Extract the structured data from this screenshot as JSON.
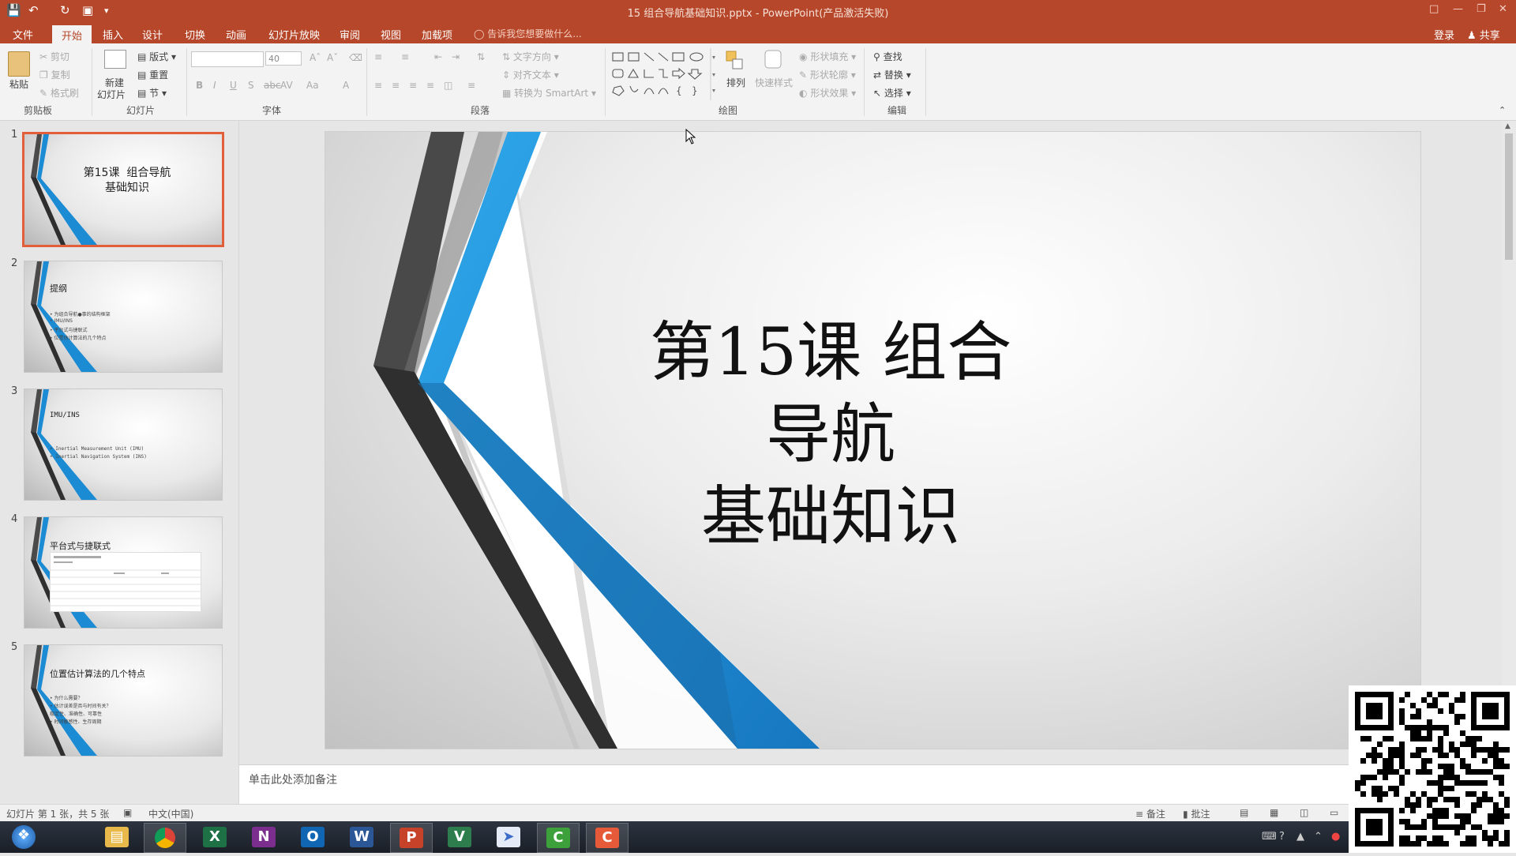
{
  "window": {
    "title": "15 组合导航基础知识.pptx - PowerPoint(产品激活失败)",
    "account_label": "登录",
    "share_label": "共享"
  },
  "tabs": [
    "文件",
    "开始",
    "插入",
    "设计",
    "切换",
    "动画",
    "幻灯片放映",
    "审阅",
    "视图",
    "加载项"
  ],
  "active_tab": "开始",
  "tell_me": "告诉我您想要做什么...",
  "ribbon": {
    "clipboard": {
      "paste": "粘贴",
      "cut": "剪切",
      "copy": "复制",
      "format_painter": "格式刷",
      "label": "剪贴板"
    },
    "slides": {
      "new_slide_line1": "新建",
      "new_slide_line2": "幻灯片",
      "layout": "版式",
      "reset": "重置",
      "section": "节",
      "label": "幻灯片"
    },
    "font": {
      "font_name": "",
      "font_size": "40",
      "label": "字体"
    },
    "paragraph": {
      "text_direction": "文字方向",
      "align_text": "对齐文本",
      "smartart": "转换为 SmartArt",
      "label": "段落"
    },
    "drawing": {
      "arrange": "排列",
      "quick_styles": "快速样式",
      "shape_fill": "形状填充",
      "shape_outline": "形状轮廓",
      "shape_effects": "形状效果",
      "label": "绘图"
    },
    "editing": {
      "find": "查找",
      "replace": "替换",
      "select": "选择",
      "label": "编辑"
    }
  },
  "thumbnails": [
    {
      "num": "1",
      "title": "第15课  组合导航\n基础知识",
      "bullets": []
    },
    {
      "num": "2",
      "title": "提纲",
      "bullets": [
        "• 为组合导航●事的结构框架",
        "• IMU/INS",
        "• 平台式与捷联式",
        "• 位置估计算法的几个特点"
      ]
    },
    {
      "num": "3",
      "title": "IMU/INS",
      "bullets": [
        "• Inertial Measurement Unit (IMU)",
        "• Inertial Navigation System (INS)"
      ]
    },
    {
      "num": "4",
      "title": "平台式与捷联式",
      "bullets": []
    },
    {
      "num": "5",
      "title": "位置估计算法的几个特点",
      "bullets": [
        "• 为什么需要？",
        "• 估计误差是否与时间有关？",
        "   稳定性、准确性、可靠性",
        "• 时间敏感性、生存周期"
      ]
    }
  ],
  "slide": {
    "title_line1": "第15课  组合导航",
    "title_line2": "基础知识"
  },
  "notes_placeholder": "单击此处添加备注",
  "status": {
    "slide_info": "幻灯片 第 1 张，共 5 张",
    "language": "中文(中国)",
    "notes": "备注",
    "comments": "批注"
  },
  "colors": {
    "accent": "#b7472a",
    "selected_border": "#e35f3c",
    "stripe_blue": "#1b8bd4",
    "stripe_dark": "#3c3c3c"
  },
  "taskbar_apps": [
    "start-icon",
    "file-explorer-icon",
    "chrome-icon",
    "excel-icon",
    "onenote-icon",
    "outlook-icon",
    "word-icon",
    "powerpoint-icon",
    "visio-icon",
    "mail-app-icon",
    "camtasia-green-icon",
    "camtasia-recorder-icon"
  ]
}
